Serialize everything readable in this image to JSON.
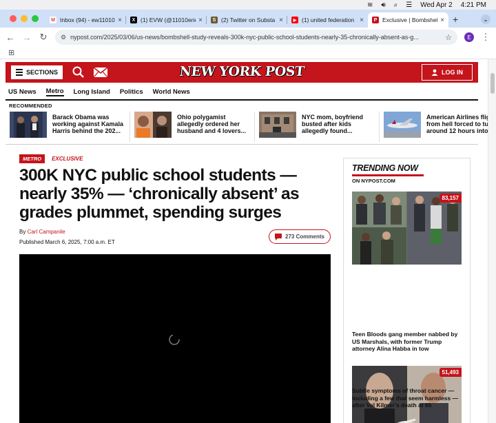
{
  "system": {
    "date": "Wed Apr 2",
    "time": "4:21 PM"
  },
  "browser": {
    "tabs": [
      {
        "label": "Inbox (94) - ew11010",
        "favicon": "gmail-icon",
        "color": "#ea4335",
        "glyph": "M"
      },
      {
        "label": "(1) EVW (@11010erie",
        "favicon": "x-icon",
        "color": "#000000",
        "glyph": "X"
      },
      {
        "label": "(2) Twitter on Substa",
        "favicon": "substack-icon",
        "color": "#6b5a2e",
        "glyph": "S"
      },
      {
        "label": "(1) united federation",
        "favicon": "youtube-icon",
        "color": "#ff0000",
        "glyph": "▶"
      },
      {
        "label": "Exclusive | Bombshel",
        "favicon": "nypost-icon",
        "color": "#c4141c",
        "glyph": "P"
      }
    ],
    "url": "nypost.com/2025/03/06/us-news/bombshell-study-reveals-300k-nyc-public-school-students-nearly-35-chronically-absent-as-g...",
    "profile_initial": "E"
  },
  "site": {
    "sections_label": "SECTIONS",
    "logo": "NEW YORK POST",
    "login_label": "LOG IN",
    "nav": [
      "US News",
      "Metro",
      "Long Island",
      "Politics",
      "World News"
    ],
    "recommended_label": "RECOMMENDED",
    "recommended": [
      "Barack Obama was working against Kamala Harris behind the 202...",
      "Ohio polygamist allegedly ordered her husband and 4 lovers...",
      "NYC mom, boyfriend busted after kids allegedly found...",
      "American Airlines flig from hell forced to tu around 12 hours into..."
    ]
  },
  "article": {
    "section_tag": "METRO",
    "exclusive_tag": "EXCLUSIVE",
    "headline": "300K NYC public school students — nearly 35% — ‘chronically absent’ as grades plummet, spending surges",
    "by": "By",
    "author": "Carl Campanile",
    "published": "Published March 6, 2025, 7:00 a.m. ET",
    "comments": "273 Comments"
  },
  "trending": {
    "title": "TRENDING NOW",
    "subtitle": "ON NYPOST.COM",
    "items": [
      {
        "count": "83,157",
        "text": "Teen Bloods gang member nabbed by US Marshals, with former Trump attorney Alina Habba in tow"
      },
      {
        "count": "51,493",
        "text": "Subtle symptoms of throat cancer — including a few that seem harmless — after Val Kilmer's death at 65"
      }
    ]
  },
  "colors": {
    "brand_red": "#c4141c",
    "tab_strip": "#cfe0f7"
  }
}
